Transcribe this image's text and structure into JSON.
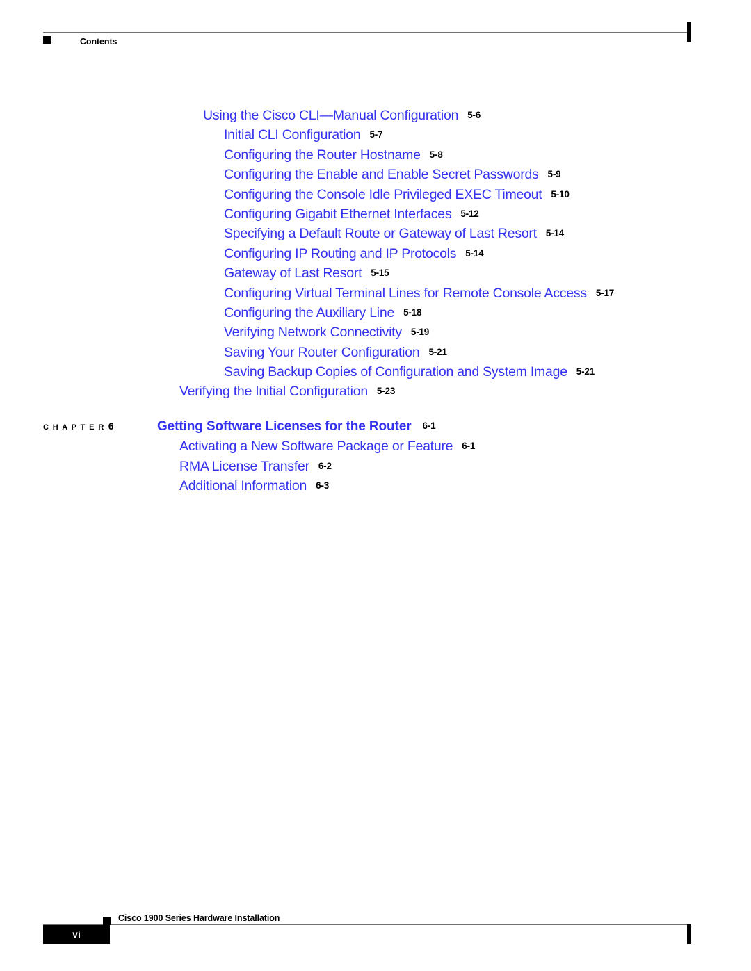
{
  "header": {
    "title": "Contents",
    "bullet_icon": "black-square-bullet"
  },
  "colors": {
    "link_blue": "#3432EE",
    "text_black": "#000000",
    "rule_gray": "#6F6F6F"
  },
  "toc": {
    "entries": [
      {
        "label": "Using the Cisco CLI—Manual Configuration",
        "page": "5-6",
        "level": 2
      },
      {
        "label": "Initial CLI Configuration",
        "page": "5-7",
        "level": 3
      },
      {
        "label": "Configuring the Router Hostname",
        "page": "5-8",
        "level": 3
      },
      {
        "label": "Configuring the Enable and Enable Secret Passwords",
        "page": "5-9",
        "level": 3
      },
      {
        "label": "Configuring the Console Idle Privileged EXEC Timeout",
        "page": "5-10",
        "level": 3
      },
      {
        "label": "Configuring Gigabit Ethernet Interfaces",
        "page": "5-12",
        "level": 3
      },
      {
        "label": "Specifying a Default Route or Gateway of Last Resort",
        "page": "5-14",
        "level": 3
      },
      {
        "label": "Configuring IP Routing and IP Protocols",
        "page": "5-14",
        "level": 3
      },
      {
        "label": "Gateway of Last Resort",
        "page": "5-15",
        "level": 3
      },
      {
        "label": "Configuring Virtual Terminal Lines for Remote Console Access",
        "page": "5-17",
        "level": 3
      },
      {
        "label": "Configuring the Auxiliary Line",
        "page": "5-18",
        "level": 3
      },
      {
        "label": "Verifying Network Connectivity",
        "page": "5-19",
        "level": 3
      },
      {
        "label": "Saving Your Router Configuration",
        "page": "5-21",
        "level": 3
      },
      {
        "label": "Saving Backup Copies of Configuration and System Image",
        "page": "5-21",
        "level": 3
      },
      {
        "label": "Verifying the Initial Configuration",
        "page": "5-23",
        "level": 1
      }
    ],
    "chapter": {
      "tag": "C H A P T E R",
      "number": "6",
      "title": "Getting Software Licenses for the Router",
      "page": "6-1",
      "entries": [
        {
          "label": "Activating a New Software Package or Feature",
          "page": "6-1"
        },
        {
          "label": "RMA License Transfer",
          "page": "6-2"
        },
        {
          "label": "Additional Information",
          "page": "6-3"
        }
      ]
    }
  },
  "footer": {
    "page_number": "vi",
    "document_title": "Cisco 1900 Series Hardware Installation",
    "bullet_icon": "black-square-bullet"
  }
}
